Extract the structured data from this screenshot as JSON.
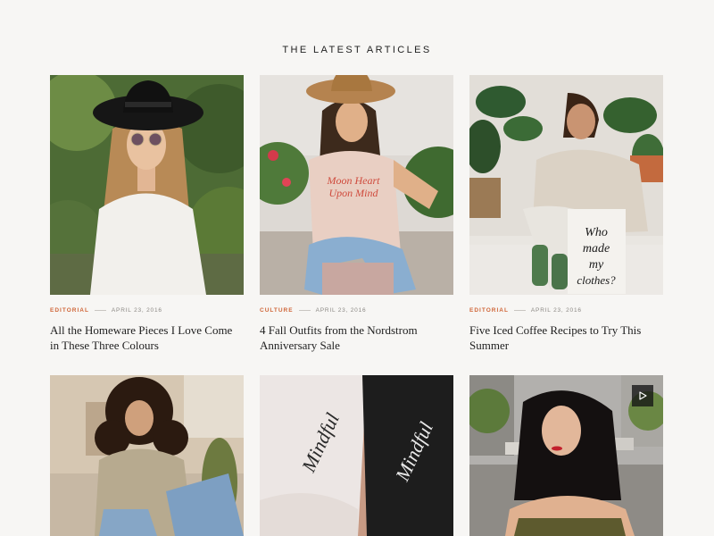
{
  "section": {
    "title": "THE LATEST ARTICLES"
  },
  "articles": [
    {
      "category": "EDITORIAL",
      "date": "APRIL 23, 2016",
      "title": "All the Homeware Pieces I Love Come in These Three Colours",
      "image": "woman-in-black-hat-and-sunglasses"
    },
    {
      "category": "CULTURE",
      "date": "APRIL 23, 2016",
      "title": "4 Fall Outfits from the Nordstrom Anniversary Sale",
      "image": "woman-in-tan-hat-graphic-tee",
      "tee_text": "Moon Heart Upon Mind"
    },
    {
      "category": "EDITORIAL",
      "date": "APRIL 23, 2016",
      "title": "Five Iced Coffee Recipes to Try This Summer",
      "image": "woman-holding-bag-plants",
      "bag_text": "Who made my clothes?"
    },
    {
      "image": "curly-hair-woman-sitting"
    },
    {
      "image": "two-people-sleeve-script",
      "sleeve_text": "Mindful"
    },
    {
      "image": "woman-street-portrait",
      "has_video": true,
      "play_icon": "play-icon"
    }
  ],
  "colors": {
    "accent": "#d0673a",
    "background": "#f7f6f4"
  }
}
